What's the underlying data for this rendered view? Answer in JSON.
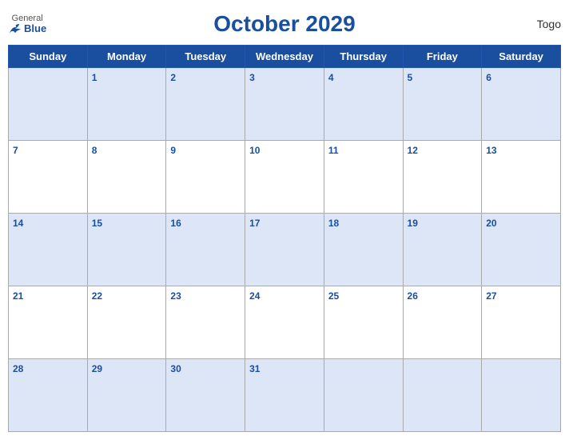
{
  "header": {
    "title": "October 2029",
    "country": "Togo",
    "logo_general": "General",
    "logo_blue": "Blue"
  },
  "days_of_week": [
    "Sunday",
    "Monday",
    "Tuesday",
    "Wednesday",
    "Thursday",
    "Friday",
    "Saturday"
  ],
  "weeks": [
    [
      "",
      "1",
      "2",
      "3",
      "4",
      "5",
      "6"
    ],
    [
      "7",
      "8",
      "9",
      "10",
      "11",
      "12",
      "13"
    ],
    [
      "14",
      "15",
      "16",
      "17",
      "18",
      "19",
      "20"
    ],
    [
      "21",
      "22",
      "23",
      "24",
      "25",
      "26",
      "27"
    ],
    [
      "28",
      "29",
      "30",
      "31",
      "",
      "",
      ""
    ]
  ]
}
